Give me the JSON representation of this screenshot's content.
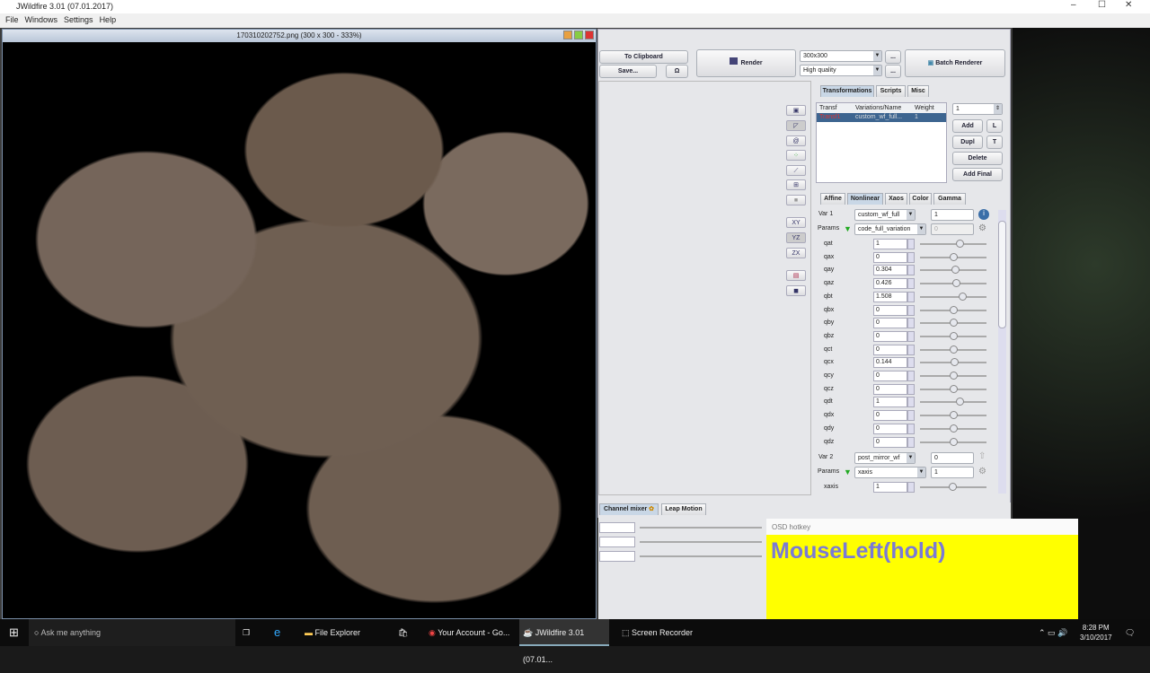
{
  "window": {
    "title": "JWildfire 3.01 (07.01.2017)"
  },
  "menu": [
    "File",
    "Windows",
    "Settings",
    "Help"
  ],
  "image_window": {
    "title": "170310202752.png (300 x 300 - 333%)"
  },
  "toolbar": {
    "to_clipboard": "To Clipboard",
    "save": "Save...",
    "omega": "Ω",
    "render": "Render",
    "size": "300x300",
    "quality": "High quality",
    "more": "...",
    "batch": "Batch Renderer"
  },
  "side_tools": [
    "XY",
    "YZ",
    "ZX"
  ],
  "tabs": [
    "Transformations",
    "Scripts",
    "Misc"
  ],
  "table": {
    "headers": [
      "Transf",
      "Variations/Name",
      "Weight"
    ],
    "rows": [
      [
        "Transf1",
        "custom_wf_full...",
        "1"
      ]
    ]
  },
  "transform_buttons": {
    "spinner": "1",
    "add": "Add",
    "l": "L",
    "dupl": "Dupl",
    "t": "T",
    "delete": "Delete",
    "add_final": "Add Final"
  },
  "subtabs": [
    "Affine",
    "Nonlinear",
    "Xaos",
    "Color",
    "Gamma"
  ],
  "var1": {
    "label": "Var 1",
    "name": "custom_wf_full",
    "amount": "1",
    "params_label": "Params",
    "param_name": "code_full_variation",
    "param_value": "0"
  },
  "params": [
    {
      "name": "qat",
      "value": "1",
      "slider": 0.6
    },
    {
      "name": "qax",
      "value": "0",
      "slider": 0.5
    },
    {
      "name": "qay",
      "value": "0.304",
      "slider": 0.53
    },
    {
      "name": "qaz",
      "value": "0.426",
      "slider": 0.54
    },
    {
      "name": "qbt",
      "value": "1.508",
      "slider": 0.63
    },
    {
      "name": "qbx",
      "value": "0",
      "slider": 0.5
    },
    {
      "name": "qby",
      "value": "0",
      "slider": 0.5
    },
    {
      "name": "qbz",
      "value": "0",
      "slider": 0.5
    },
    {
      "name": "qct",
      "value": "0",
      "slider": 0.5
    },
    {
      "name": "qcx",
      "value": "0.144",
      "slider": 0.51
    },
    {
      "name": "qcy",
      "value": "0",
      "slider": 0.5
    },
    {
      "name": "qcz",
      "value": "0",
      "slider": 0.5
    },
    {
      "name": "qdt",
      "value": "1",
      "slider": 0.6
    },
    {
      "name": "qdx",
      "value": "0",
      "slider": 0.5
    },
    {
      "name": "qdy",
      "value": "0",
      "slider": 0.5
    },
    {
      "name": "qdz",
      "value": "0",
      "slider": 0.5
    }
  ],
  "var2": {
    "label": "Var 2",
    "name": "post_mirror_wf",
    "amount": "0",
    "params_label": "Params",
    "param_name": "xaxis",
    "param_value": "1",
    "sub_name": "xaxis",
    "sub_value": "1"
  },
  "bottom_tabs": [
    "Channel mixer",
    "Leap Motion"
  ],
  "osd": {
    "title": "OSD hotkey",
    "text": "MouseLeft(hold)"
  },
  "taskbar": {
    "search": "Ask me anything",
    "items": [
      "File Explorer",
      "Your Account - Go...",
      "JWildfire 3.01 (07.01...",
      "Screen Recorder"
    ],
    "time": "8:28 PM",
    "date": "3/10/2017"
  }
}
